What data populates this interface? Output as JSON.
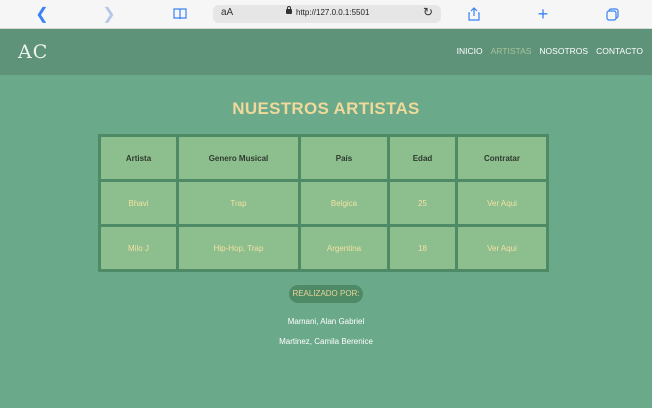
{
  "browser": {
    "text_size_label": "aA",
    "url": "http://127.0.0.1:5501"
  },
  "site": {
    "logo": "AC",
    "nav": [
      "INICIO",
      "ARTISTAS",
      "NOSOTROS",
      "CONTACTO"
    ]
  },
  "main": {
    "title": "NUESTROS ARTISTAS",
    "table": {
      "headers": [
        "Artista",
        "Genero Musical",
        "País",
        "Edad",
        "Contratar"
      ],
      "rows": [
        [
          "Bhavi",
          "Trap",
          "Belgica",
          "25",
          "Ver Aqui"
        ],
        [
          "Milo J",
          "Hip-Hop, Trap",
          "Argentina",
          "18",
          "Ver Aqui"
        ]
      ]
    },
    "credits": {
      "label": "REALIZADO POR:",
      "authors": [
        "Mamani, Alan Gabriel",
        "Martinez, Camila Berenice"
      ]
    }
  }
}
